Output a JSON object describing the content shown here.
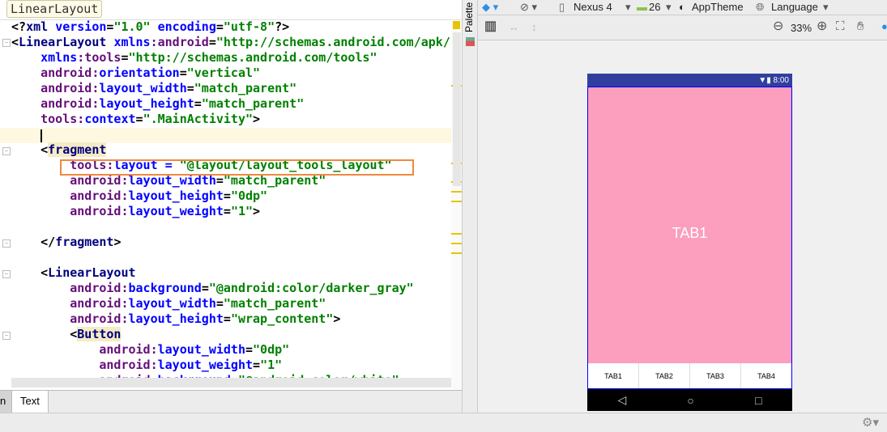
{
  "editor": {
    "breadcrumb": "LinearLayout",
    "lines": [
      [
        [
          "pi",
          "<?"
        ],
        [
          "tag",
          "xml "
        ],
        [
          "attr",
          "version"
        ],
        [
          "pun",
          "="
        ],
        [
          "val",
          "\"1.0\" "
        ],
        [
          "attr",
          "encoding"
        ],
        [
          "pun",
          "="
        ],
        [
          "val",
          "\"utf-8\""
        ],
        [
          "pi",
          "?>"
        ]
      ],
      [
        [
          "pun",
          "<"
        ],
        [
          "tag",
          "LinearLayout "
        ],
        [
          "attr",
          "xmlns"
        ],
        [
          "ns",
          ":android"
        ],
        [
          "pun",
          "="
        ],
        [
          "val",
          "\"http://schemas.android.com/apk/re"
        ]
      ],
      [
        [
          "sp",
          "    "
        ],
        [
          "attr",
          "xmlns"
        ],
        [
          "ns",
          ":tools"
        ],
        [
          "pun",
          "="
        ],
        [
          "val",
          "\"http://schemas.android.com/tools\""
        ]
      ],
      [
        [
          "sp",
          "    "
        ],
        [
          "ns",
          "android:"
        ],
        [
          "attr",
          "orientation"
        ],
        [
          "pun",
          "="
        ],
        [
          "val",
          "\"vertical\""
        ]
      ],
      [
        [
          "sp",
          "    "
        ],
        [
          "ns",
          "android:"
        ],
        [
          "attr",
          "layout_width"
        ],
        [
          "pun",
          "="
        ],
        [
          "val",
          "\"match_parent\""
        ]
      ],
      [
        [
          "sp",
          "    "
        ],
        [
          "ns",
          "android:"
        ],
        [
          "attr",
          "layout_height"
        ],
        [
          "pun",
          "="
        ],
        [
          "val",
          "\"match_parent\""
        ]
      ],
      [
        [
          "sp",
          "    "
        ],
        [
          "ns",
          "tools:"
        ],
        [
          "attr",
          "context"
        ],
        [
          "pun",
          "="
        ],
        [
          "val",
          "\".MainActivity\""
        ],
        [
          "pun",
          ">"
        ]
      ],
      [],
      [
        [
          "sp",
          "    "
        ],
        [
          "pun",
          "<"
        ],
        [
          "tag hl",
          "fragment"
        ]
      ],
      [
        [
          "sp",
          "        "
        ],
        [
          "ns",
          "tools:"
        ],
        [
          "attr",
          "layout = "
        ],
        [
          "val",
          "\"@layout/layout_tools_layout\""
        ]
      ],
      [
        [
          "sp",
          "        "
        ],
        [
          "ns",
          "android:"
        ],
        [
          "attr",
          "layout_width"
        ],
        [
          "pun",
          "="
        ],
        [
          "val",
          "\"match_parent\""
        ]
      ],
      [
        [
          "sp",
          "        "
        ],
        [
          "ns",
          "android:"
        ],
        [
          "attr",
          "layout_height"
        ],
        [
          "pun",
          "="
        ],
        [
          "val",
          "\"0dp\""
        ]
      ],
      [
        [
          "sp",
          "        "
        ],
        [
          "ns",
          "android:"
        ],
        [
          "attr",
          "layout_weight"
        ],
        [
          "pun",
          "="
        ],
        [
          "val",
          "\"1\""
        ],
        [
          "pun",
          ">"
        ]
      ],
      [],
      [
        [
          "sp",
          "    "
        ],
        [
          "pun",
          "</"
        ],
        [
          "tag",
          "fragment"
        ],
        [
          "pun",
          ">"
        ]
      ],
      [],
      [
        [
          "sp",
          "    "
        ],
        [
          "pun",
          "<"
        ],
        [
          "tag",
          "LinearLayout"
        ]
      ],
      [
        [
          "sp",
          "        "
        ],
        [
          "ns",
          "android:"
        ],
        [
          "attr",
          "background"
        ],
        [
          "pun",
          "="
        ],
        [
          "val",
          "\"@android:color/darker_gray\""
        ]
      ],
      [
        [
          "sp",
          "        "
        ],
        [
          "ns",
          "android:"
        ],
        [
          "attr",
          "layout_width"
        ],
        [
          "pun",
          "="
        ],
        [
          "val",
          "\"match_parent\""
        ]
      ],
      [
        [
          "sp",
          "        "
        ],
        [
          "ns",
          "android:"
        ],
        [
          "attr",
          "layout_height"
        ],
        [
          "pun",
          "="
        ],
        [
          "val",
          "\"wrap_content\""
        ],
        [
          "pun",
          ">"
        ]
      ],
      [
        [
          "sp",
          "        "
        ],
        [
          "pun",
          "<"
        ],
        [
          "tag hl",
          "Button"
        ]
      ],
      [
        [
          "sp",
          "            "
        ],
        [
          "ns",
          "android:"
        ],
        [
          "attr",
          "layout_width"
        ],
        [
          "pun",
          "="
        ],
        [
          "val",
          "\"0dp\""
        ]
      ],
      [
        [
          "sp",
          "            "
        ],
        [
          "ns",
          "android:"
        ],
        [
          "attr",
          "layout_weight"
        ],
        [
          "pun",
          "="
        ],
        [
          "val",
          "\"1\""
        ]
      ],
      [
        [
          "sp",
          "            "
        ],
        [
          "ns",
          "android:"
        ],
        [
          "attr",
          "background"
        ],
        [
          "pun",
          "="
        ],
        [
          "val",
          "\"@android:color/white\""
        ]
      ]
    ],
    "bottom_tabs": {
      "design_partial": "n",
      "text": "Text"
    }
  },
  "palette": {
    "label": "Palette"
  },
  "designer": {
    "toolbar1": {
      "device": "Nexus 4",
      "api": "26",
      "theme": "AppTheme",
      "language": "Language"
    },
    "toolbar2": {
      "zoom": "33%"
    },
    "phone": {
      "time": "8:00",
      "content": "TAB1",
      "tabs": [
        "TAB1",
        "TAB2",
        "TAB3",
        "TAB4"
      ],
      "nav": [
        "◁",
        "○",
        "□"
      ]
    }
  },
  "colors": {
    "status_bar": "#303f9f",
    "screen": "#fc9ebd",
    "highlight_box": "#f0883e"
  }
}
